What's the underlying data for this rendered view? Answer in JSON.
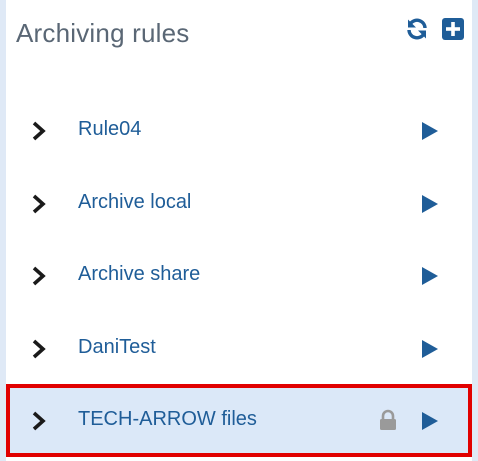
{
  "panel": {
    "title": "Archiving rules",
    "actions": [
      {
        "name": "refresh-icon"
      },
      {
        "name": "add-icon"
      }
    ]
  },
  "rules": [
    {
      "label": "Rule04",
      "locked": false,
      "selected": false
    },
    {
      "label": "Archive local",
      "locked": false,
      "selected": false
    },
    {
      "label": "Archive share",
      "locked": false,
      "selected": false
    },
    {
      "label": "DaniTest",
      "locked": false,
      "selected": false
    },
    {
      "label": "TECH-ARROW files",
      "locked": true,
      "selected": true
    }
  ],
  "colors": {
    "accent": "#1f5d98",
    "selected_bg": "#dbe8f8",
    "highlight_border": "#e10000",
    "page_bg": "#dfe9f6"
  }
}
